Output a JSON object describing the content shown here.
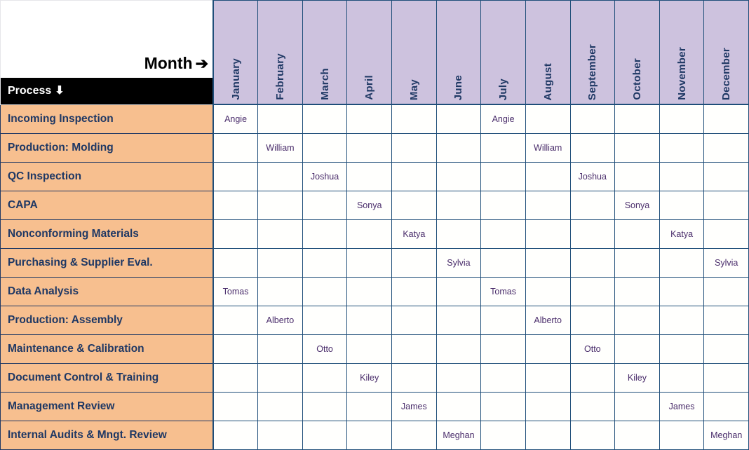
{
  "corner": {
    "month_label": "Month",
    "month_arrow": "➔",
    "process_label": "Process",
    "process_arrow": "⬇"
  },
  "colors": {
    "header_bg": "#cdc2de",
    "header_text": "#1f3864",
    "process_bar_bg": "#000000",
    "process_bar_text": "#ffffff",
    "row_label_bg": "#f7bf8f",
    "row_label_text": "#1f3864",
    "grid_border": "#1f4e79",
    "cell_bg": "#fffffd",
    "name_text": "#4a2d6b",
    "corner_text": "#000000"
  },
  "columns": [
    "January",
    "February",
    "March",
    "April",
    "May",
    "June",
    "July",
    "August",
    "September",
    "October",
    "November",
    "December"
  ],
  "rows": [
    {
      "process": "Incoming Inspection",
      "cells": [
        "Angie",
        "",
        "",
        "",
        "",
        "",
        "Angie",
        "",
        "",
        "",
        "",
        ""
      ]
    },
    {
      "process": "Production: Molding",
      "cells": [
        "",
        "William",
        "",
        "",
        "",
        "",
        "",
        "William",
        "",
        "",
        "",
        ""
      ]
    },
    {
      "process": "QC Inspection",
      "cells": [
        "",
        "",
        "Joshua",
        "",
        "",
        "",
        "",
        "",
        "Joshua",
        "",
        "",
        ""
      ]
    },
    {
      "process": "CAPA",
      "cells": [
        "",
        "",
        "",
        "Sonya",
        "",
        "",
        "",
        "",
        "",
        "Sonya",
        "",
        ""
      ]
    },
    {
      "process": "Nonconforming Materials",
      "cells": [
        "",
        "",
        "",
        "",
        "Katya",
        "",
        "",
        "",
        "",
        "",
        "Katya",
        ""
      ]
    },
    {
      "process": "Purchasing & Supplier Eval.",
      "cells": [
        "",
        "",
        "",
        "",
        "",
        "Sylvia",
        "",
        "",
        "",
        "",
        "",
        "Sylvia"
      ]
    },
    {
      "process": "Data Analysis",
      "cells": [
        "Tomas",
        "",
        "",
        "",
        "",
        "",
        "Tomas",
        "",
        "",
        "",
        "",
        ""
      ]
    },
    {
      "process": "Production: Assembly",
      "cells": [
        "",
        "Alberto",
        "",
        "",
        "",
        "",
        "",
        "Alberto",
        "",
        "",
        "",
        ""
      ]
    },
    {
      "process": "Maintenance & Calibration",
      "cells": [
        "",
        "",
        "Otto",
        "",
        "",
        "",
        "",
        "",
        "Otto",
        "",
        "",
        ""
      ]
    },
    {
      "process": "Document Control & Training",
      "cells": [
        "",
        "",
        "",
        "Kiley",
        "",
        "",
        "",
        "",
        "",
        "Kiley",
        "",
        ""
      ]
    },
    {
      "process": "Management Review",
      "cells": [
        "",
        "",
        "",
        "",
        "James",
        "",
        "",
        "",
        "",
        "",
        "James",
        ""
      ]
    },
    {
      "process": "Internal Audits & Mngt. Review",
      "cells": [
        "",
        "",
        "",
        "",
        "",
        "Meghan",
        "",
        "",
        "",
        "",
        "",
        "Meghan"
      ]
    }
  ]
}
